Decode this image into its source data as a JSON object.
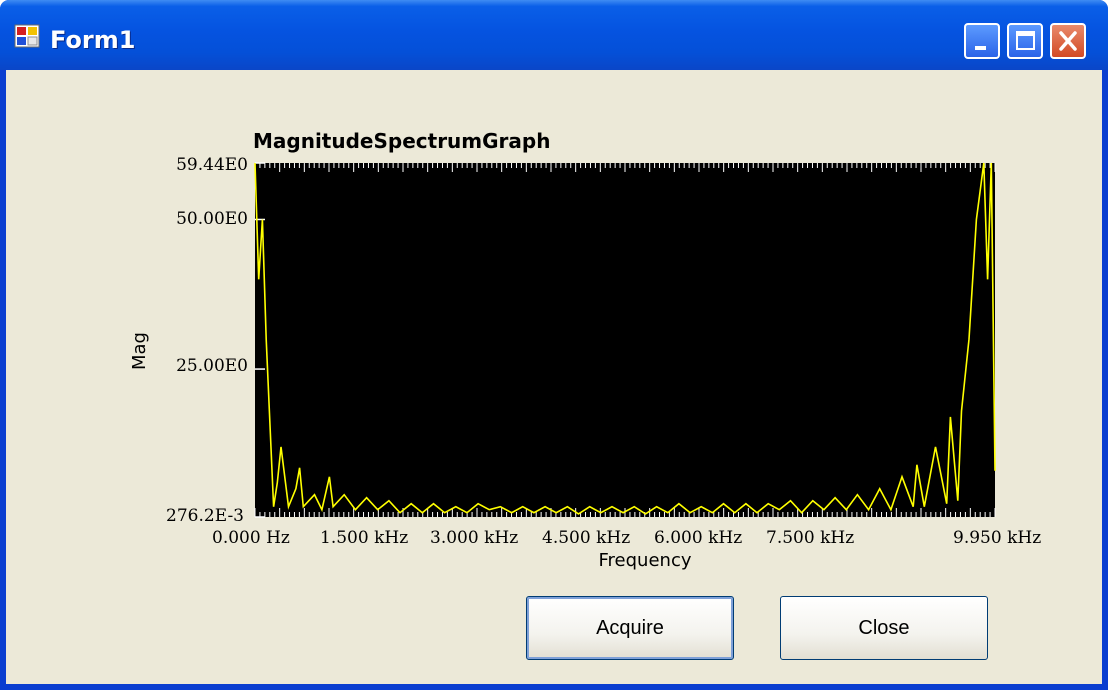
{
  "window": {
    "title": "Form1"
  },
  "graph": {
    "title": "MagnitudeSpectrumGraph"
  },
  "buttons": {
    "acquire": "Acquire",
    "close": "Close"
  },
  "colors": {
    "plot_bg": "#000000",
    "trace": "#ffff00",
    "client_bg": "#ece9d8"
  },
  "chart_data": {
    "type": "line",
    "title": "MagnitudeSpectrumGraph",
    "xlabel": "Frequency",
    "ylabel": "Mag",
    "xlim": [
      0,
      9950
    ],
    "ylim": [
      0.2762,
      59.44
    ],
    "x_tick_labels": [
      "0.000 Hz",
      "1.500 kHz",
      "3.000 kHz",
      "4.500 kHz",
      "6.000 kHz",
      "7.500 kHz",
      "9.950 kHz"
    ],
    "x_tick_values": [
      0,
      1500,
      3000,
      4500,
      6000,
      7500,
      9950
    ],
    "y_tick_labels": [
      "59.44E0",
      "50.00E0",
      "25.00E0",
      "276.2E-3"
    ],
    "y_tick_values": [
      59.44,
      50.0,
      25.0,
      0.2762
    ],
    "series": [
      {
        "x": [
          0,
          50,
          100,
          150,
          250,
          300,
          350,
          450,
          550,
          600,
          650,
          800,
          900,
          1000,
          1050,
          1200,
          1350,
          1500,
          1650,
          1800,
          1950,
          2100,
          2250,
          2400,
          2550,
          2700,
          2850,
          3000,
          3150,
          3300,
          3450,
          3600,
          3750,
          3900,
          4050,
          4200,
          4350,
          4500,
          4650,
          4800,
          4950,
          5100,
          5250,
          5400,
          5550,
          5700,
          5850,
          6000,
          6150,
          6300,
          6450,
          6600,
          6750,
          6900,
          7050,
          7200,
          7350,
          7500,
          7650,
          7800,
          7950,
          8100,
          8250,
          8400,
          8550,
          8700,
          8850,
          8900,
          9000,
          9150,
          9300,
          9350,
          9450,
          9500,
          9600,
          9700,
          9800,
          9850,
          9900,
          9950
        ],
        "y": [
          59.44,
          40.0,
          50.0,
          30.0,
          2.0,
          6.0,
          12.0,
          2.0,
          5.0,
          8.5,
          2.0,
          4.0,
          1.5,
          7.0,
          2.0,
          4.0,
          1.5,
          3.5,
          1.5,
          3.0,
          1.0,
          2.5,
          1.0,
          2.5,
          1.0,
          2.0,
          1.0,
          2.5,
          1.5,
          2.0,
          1.0,
          2.0,
          1.0,
          2.0,
          1.0,
          2.0,
          0.8,
          2.0,
          1.0,
          2.0,
          1.0,
          2.0,
          0.8,
          2.0,
          1.0,
          2.5,
          1.0,
          2.0,
          1.0,
          2.5,
          1.0,
          2.5,
          1.0,
          2.5,
          1.5,
          3.0,
          1.0,
          3.0,
          1.5,
          3.5,
          1.5,
          4.0,
          1.5,
          5.0,
          1.5,
          7.0,
          2.0,
          9.0,
          2.0,
          12.0,
          2.5,
          17.0,
          3.0,
          18.0,
          30.0,
          50.0,
          59.44,
          40.0,
          59.44,
          8.0
        ]
      }
    ]
  }
}
